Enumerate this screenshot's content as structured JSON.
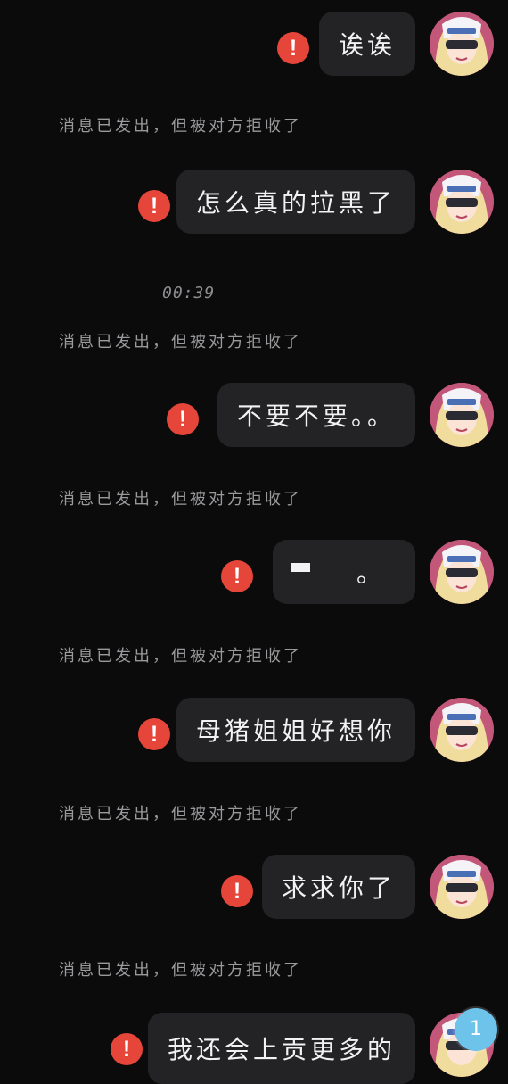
{
  "messages": [
    {
      "text": "诶诶"
    },
    {
      "text": "怎么真的拉黑了"
    },
    {
      "text": "不要不要。。"
    },
    {
      "text": "。"
    },
    {
      "text": "母猪姐姐好想你"
    },
    {
      "text": "求求你了"
    },
    {
      "text": "我还会上贡更多的"
    }
  ],
  "rejected_notice": "消息已发出，但被对方拒收了",
  "timestamp": "00:39",
  "unread_badge": "1",
  "icons": {
    "error": "error-exclamation-icon",
    "avatar": "anime-avatar-icon"
  },
  "colors": {
    "error": "#e6463a",
    "bubble": "#232325",
    "background": "#0b0b0c",
    "badge": "#6ec3ea"
  }
}
